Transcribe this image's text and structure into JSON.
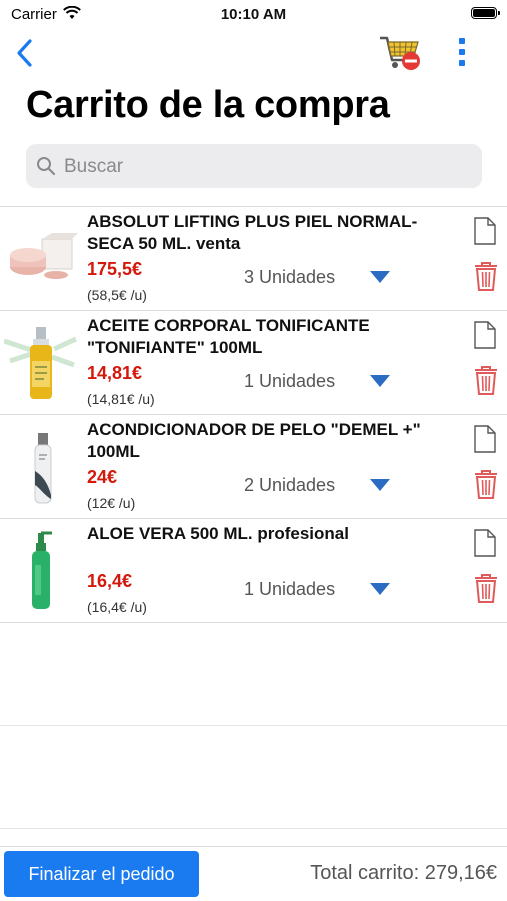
{
  "status_bar": {
    "carrier": "Carrier",
    "time": "10:10 AM"
  },
  "nav": {
    "back_icon": "chevron-left-icon",
    "cart_icon": "cart-remove-icon",
    "more_icon": "more-vertical-icon",
    "accent_color": "#1a7af0"
  },
  "page_title": "Carrito de la compra",
  "search": {
    "placeholder": "Buscar",
    "value": ""
  },
  "items": [
    {
      "name": "ABSOLUT LIFTING PLUS PIEL NORMAL-SECA 50 ML. venta",
      "price": "175,5€",
      "unit_price": "(58,5€ /u)",
      "quantity": "3 Unidades"
    },
    {
      "name": "ACEITE CORPORAL TONIFICANTE \"TONIFIANTE\" 100ML",
      "price": "14,81€",
      "unit_price": "(14,81€ /u)",
      "quantity": "1 Unidades"
    },
    {
      "name": "ACONDICIONADOR DE PELO \"DEMEL +\" 100ML",
      "price": "24€",
      "unit_price": "(12€ /u)",
      "quantity": "2 Unidades"
    },
    {
      "name": "ALOE VERA 500 ML. profesional",
      "price": "16,4€",
      "unit_price": "(16,4€ /u)",
      "quantity": "1 Unidades"
    }
  ],
  "footer": {
    "finalize_label": "Finalizar el pedido",
    "total": "Total carrito: 279,16€"
  },
  "colors": {
    "price": "#d3180c",
    "trash": "#e05a5a",
    "button": "#1a7af0"
  }
}
